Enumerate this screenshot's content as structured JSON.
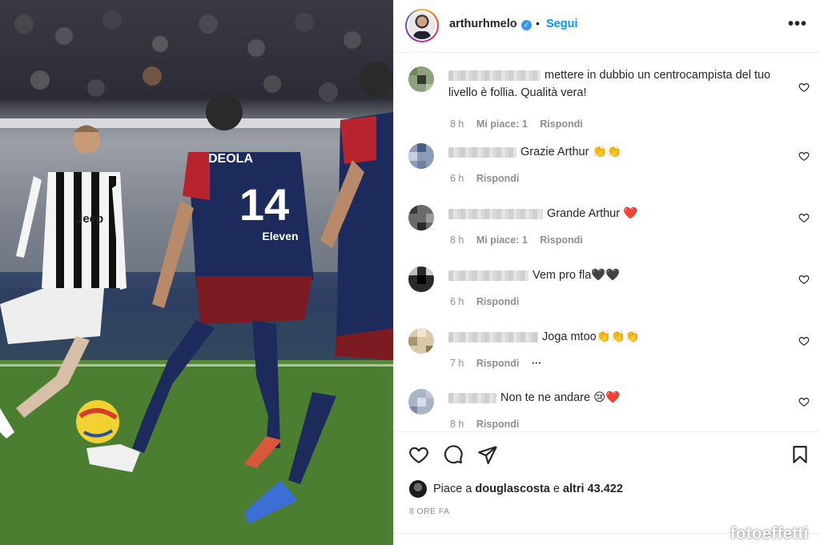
{
  "header": {
    "username": "arthurhmelo",
    "verified_glyph": "✓",
    "separator": "•",
    "follow_label": "Segui",
    "more_label": "•••"
  },
  "comments": [
    {
      "text": "mettere in dubbio un centrocampista del tuo livello è follia. Qualità vera!",
      "time": "8 h",
      "likes": "Mi piace: 1",
      "reply": "Rispondi"
    },
    {
      "text": "Grazie Arthur 👏👏",
      "time": "6 h",
      "reply": "Rispondi"
    },
    {
      "text": "Grande Arthur ❤️",
      "time": "8 h",
      "likes": "Mi piace: 1",
      "reply": "Rispondi"
    },
    {
      "text": "Vem pro fla🖤🖤",
      "time": "6 h",
      "reply": "Rispondi"
    },
    {
      "text": "Joga mtoo👏👏👏",
      "time": "7 h",
      "reply": "Rispondi",
      "more": "···"
    },
    {
      "text": "Non te ne andare 😢❤️",
      "time": "8 h",
      "reply": "Rispondi"
    }
  ],
  "likes": {
    "prefix": "Piace a",
    "user": "douglascosta",
    "conjunction": "e",
    "others": "altri 43.422"
  },
  "post_time": "8 ORE FA",
  "watermark": "fotoeffetti",
  "photo": {
    "player_number": "14",
    "shirt_name": "DEOLA",
    "sponsor_home": "Jeep",
    "sponsor_away": "Eleven"
  },
  "icons": [
    "heart-icon",
    "comment-icon",
    "share-icon",
    "bookmark-icon",
    "verified-icon",
    "more-options-icon"
  ],
  "colors": {
    "link_blue": "#0095f6",
    "verified_blue": "#3897f0",
    "muted": "#8e8e8e",
    "text": "#262626",
    "heart_red": "#ed4956"
  }
}
